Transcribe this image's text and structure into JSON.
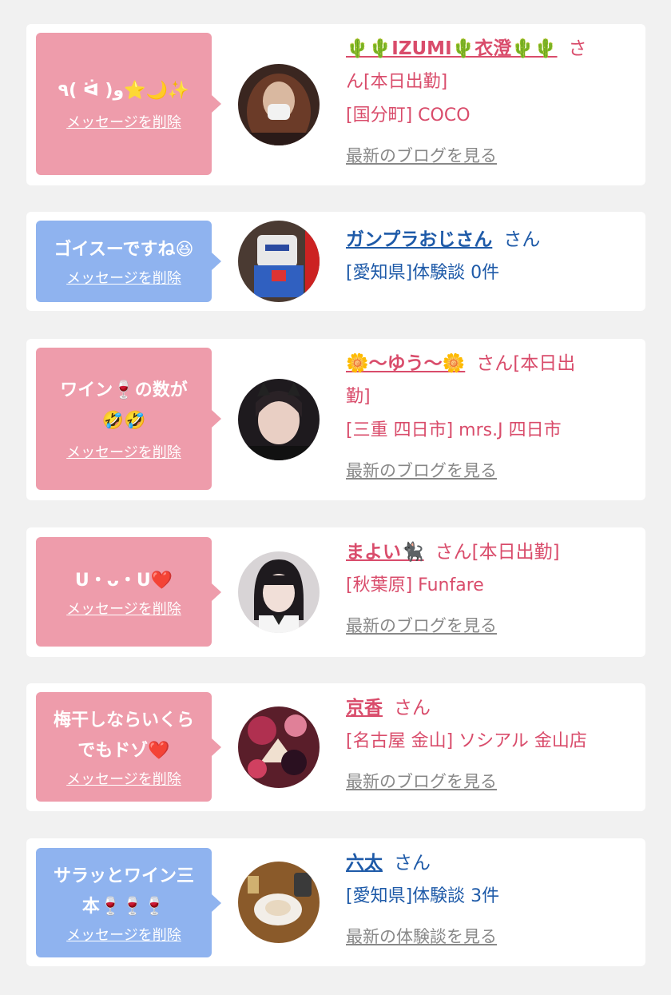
{
  "items": [
    {
      "bubble_text": "٩( ᐛ )و⭐🌙✨",
      "delete_label": "メッセージを削除",
      "name": "🌵🌵IZUMI🌵衣澄🌵🌵",
      "san": "さ",
      "status_line": "ん[本日出勤]",
      "location": "[国分町] COCO",
      "link": "最新のブログを見る"
    },
    {
      "bubble_text": "ゴイスーですね😆",
      "delete_label": "メッセージを削除",
      "name": "ガンプラおじさん",
      "san": "さん",
      "location": "[愛知県]体験談 0件"
    },
    {
      "bubble_text_1": "ワイン🍷の数が",
      "bubble_text_2": "🤣🤣",
      "delete_label": "メッセージを削除",
      "name": "🌼〜ゆう〜🌼",
      "san": "さん[本日出",
      "status_line": "勤]",
      "location": "[三重 四日市] mrs.J 四日市",
      "link": "最新のブログを見る"
    },
    {
      "bubble_text": "U・ᴗ・U❤️",
      "delete_label": "メッセージを削除",
      "name": "まよい🐈‍⬛",
      "san": "さん[本日出勤]",
      "location": "[秋葉原] Funfare",
      "link": "最新のブログを見る"
    },
    {
      "bubble_text_1": "梅干しならいくら",
      "bubble_text_2": "でもドゾ❤️",
      "delete_label": "メッセージを削除",
      "name": "京香",
      "san": "さん",
      "location": "[名古屋 金山] ソシアル 金山店",
      "link": "最新のブログを見る"
    },
    {
      "bubble_text_1": "サラッとワイン三",
      "bubble_text_2": "本🍷🍷🍷",
      "delete_label": "メッセージを削除",
      "name": "六太",
      "san": "さん",
      "location": "[愛知県]体験談 3件",
      "link": "最新の体験談を見る"
    }
  ],
  "colors": {
    "pink": "#ee9cab",
    "blue": "#8fb3ef",
    "pink_text": "#d94c6b",
    "blue_text": "#1e5aa8"
  }
}
